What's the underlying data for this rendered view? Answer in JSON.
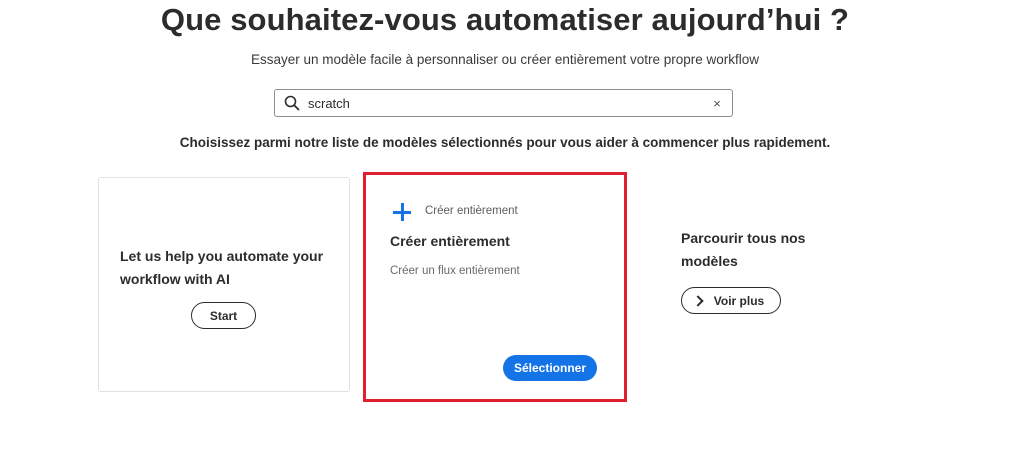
{
  "header": {
    "title": "Que souhaitez-vous automatiser aujourd’hui ?",
    "subtitle": "Essayer un modèle facile à personnaliser ou créer entièrement votre propre workflow"
  },
  "search": {
    "value": "scratch",
    "clear_symbol": "×"
  },
  "instructions": "Choisissez parmi notre liste de modèles sélectionnés pour vous aider à commencer plus rapidement.",
  "cards": {
    "ai": {
      "text": "Let us help you automate your workflow with AI",
      "button_label": "Start"
    },
    "scratch": {
      "tag": "Créer entièrement",
      "heading": "Créer entièrement",
      "description": "Créer un flux entièrement",
      "button_label": "Sélectionner",
      "icon": "plus-icon"
    },
    "browse": {
      "text": "Parcourir tous nos modèles",
      "button_label": "Voir plus",
      "icon": "chevron-right-icon"
    }
  },
  "colors": {
    "accent": "#1473e6",
    "highlight": "#e0202e",
    "text": "#2c2c2c"
  }
}
